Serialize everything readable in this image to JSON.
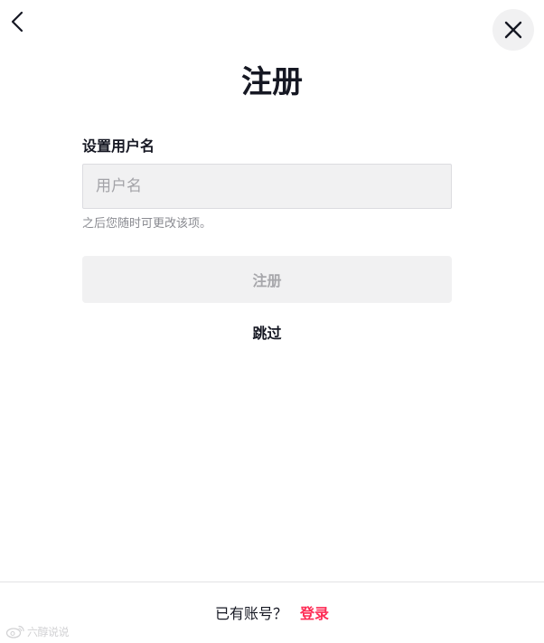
{
  "header": {
    "back_icon": "chevron-left-icon",
    "close_icon": "close-icon",
    "title": "注册"
  },
  "form": {
    "username_label": "设置用户名",
    "username_placeholder": "用户名",
    "username_value": "",
    "hint": "之后您随时可更改该项。",
    "submit_label": "注册",
    "skip_label": "跳过"
  },
  "footer": {
    "prompt": "已有账号？",
    "login_label": "登录"
  },
  "watermark": {
    "icon": "weibo-icon",
    "text": "六醇说说"
  },
  "colors": {
    "accent": "#fe2c55",
    "text": "#161823",
    "input_bg": "#f1f1f2",
    "disabled_text": "#a7a7ab"
  }
}
